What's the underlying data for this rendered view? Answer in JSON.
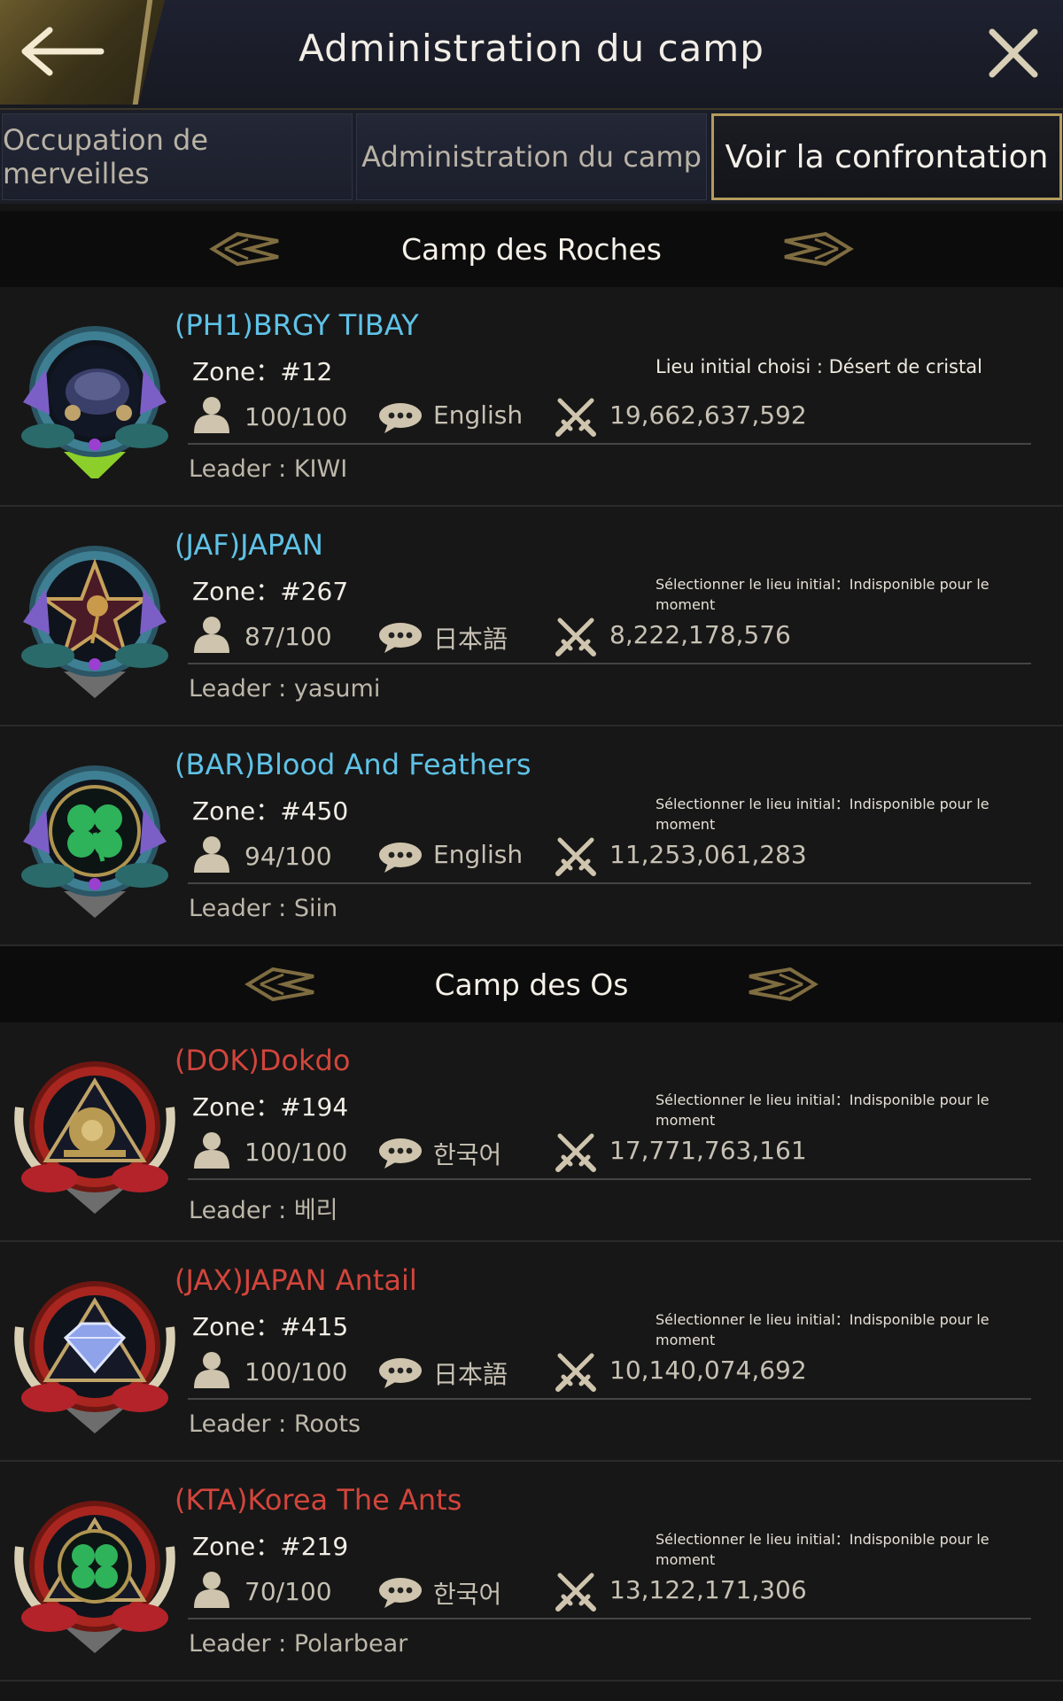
{
  "header": {
    "title": "Administration du camp"
  },
  "tabs": [
    {
      "label": "Occupation de merveilles"
    },
    {
      "label": "Administration du camp"
    },
    {
      "label": "Voir la confrontation",
      "active": true
    }
  ],
  "camps": [
    {
      "name": "Camp des Roches",
      "color": "#5fc2e6",
      "alliances": [
        {
          "name": "(PH1)BRGY TIBAY",
          "zone": "Zone：#12",
          "lieu": "Lieu initial choisi : Désert de cristal",
          "members": "100/100",
          "language": "English",
          "power": "19,662,637,592",
          "leader": "Leader : KIWI"
        },
        {
          "name": "(JAF)JAPAN",
          "zone": "Zone：#267",
          "lieu": "Sélectionner le lieu initial：Indisponible pour le moment",
          "members": "87/100",
          "language": "日本語",
          "power": "8,222,178,576",
          "leader": "Leader : yasumi"
        },
        {
          "name": "(BAR)Blood And Feathers",
          "zone": "Zone：#450",
          "lieu": "Sélectionner le lieu initial：Indisponible pour le moment",
          "members": "94/100",
          "language": "English",
          "power": "11,253,061,283",
          "leader": "Leader : Siin"
        }
      ]
    },
    {
      "name": "Camp des Os",
      "color": "#d2453c",
      "alliances": [
        {
          "name": "(DOK)Dokdo",
          "zone": "Zone：#194",
          "lieu": "Sélectionner le lieu initial：Indisponible pour le moment",
          "members": "100/100",
          "language": "한국어",
          "power": "17,771,763,161",
          "leader": "Leader : 베리"
        },
        {
          "name": "(JAX)JAPAN Antail",
          "zone": "Zone：#415",
          "lieu": "Sélectionner le lieu initial：Indisponible pour le moment",
          "members": "100/100",
          "language": "日本語",
          "power": "10,140,074,692",
          "leader": "Leader : Roots"
        },
        {
          "name": "(KTA)Korea The Ants",
          "zone": "Zone：#219",
          "lieu": "Sélectionner le lieu initial：Indisponible pour le moment",
          "members": "70/100",
          "language": "한국어",
          "power": "13,122,171,306",
          "leader": "Leader : Polarbear"
        }
      ]
    }
  ]
}
